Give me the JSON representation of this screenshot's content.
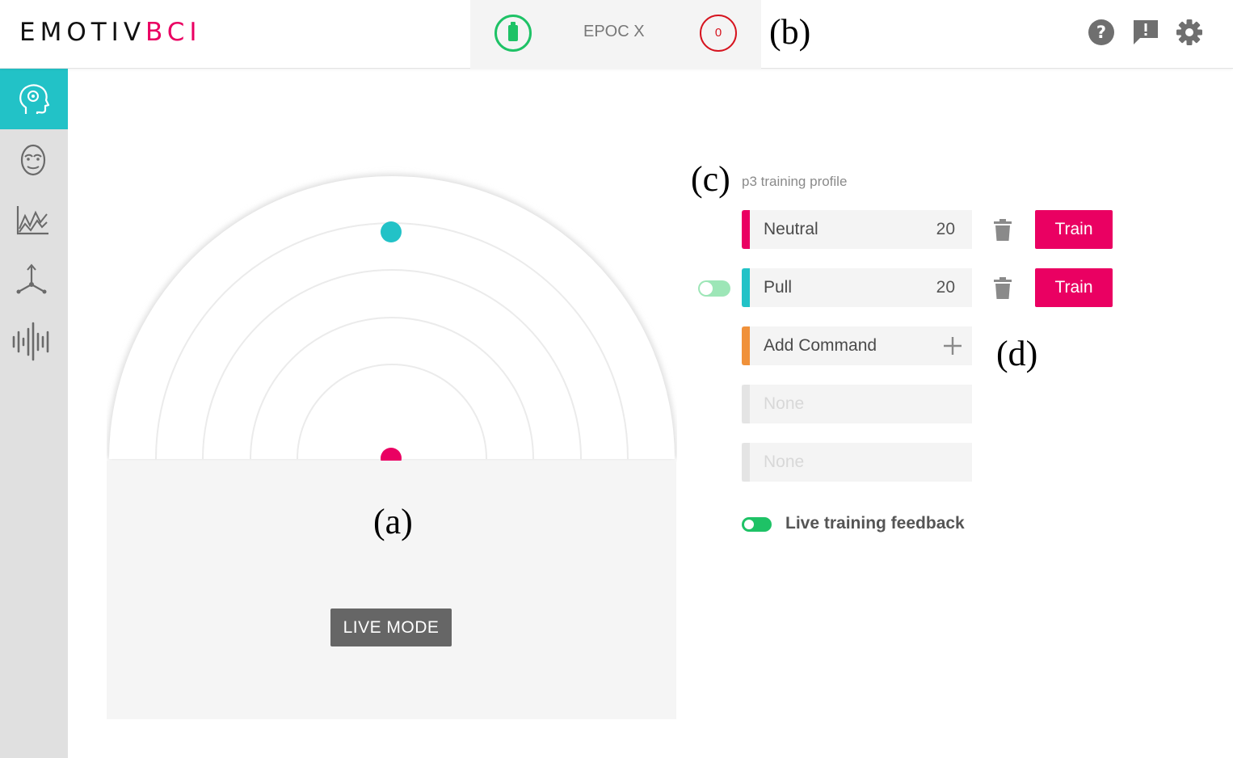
{
  "brand": {
    "part1": "EMOTIV",
    "part2": "BCI",
    "color_dark": "#111111",
    "color_accent": "#ea0062"
  },
  "device": {
    "name": "EPOC X",
    "signal_value": "0",
    "battery_icon": "battery-icon",
    "battery_color": "#1ec266",
    "signal_color": "#d6141f"
  },
  "header_icons": [
    "help-icon",
    "feedback-icon",
    "settings-icon"
  ],
  "sidebar": {
    "items": [
      "mental-commands-icon",
      "facial-expressions-icon",
      "performance-metrics-icon",
      "motion-icon",
      "raw-eeg-icon"
    ],
    "active_color": "#22c2c7"
  },
  "figure_labels": {
    "a": "(a)",
    "b": "(b)",
    "c": "(c)",
    "d": "(d)"
  },
  "visualization": {
    "live_mode_label": "LIVE MODE",
    "target_color": "#22c2c7",
    "cursor_color": "#ea0062"
  },
  "profile": {
    "label": "p3 training profile"
  },
  "commands": [
    {
      "name": "Neutral",
      "count": "20",
      "color": "#ea0062",
      "train_label": "Train"
    },
    {
      "name": "Pull",
      "count": "20",
      "color": "#22c2c7",
      "train_label": "Train"
    },
    {
      "name": "Add Command",
      "color": "#f0913a"
    },
    {
      "name": "None"
    },
    {
      "name": "None"
    }
  ],
  "live_feedback": {
    "label": "Live training feedback",
    "on": true
  }
}
